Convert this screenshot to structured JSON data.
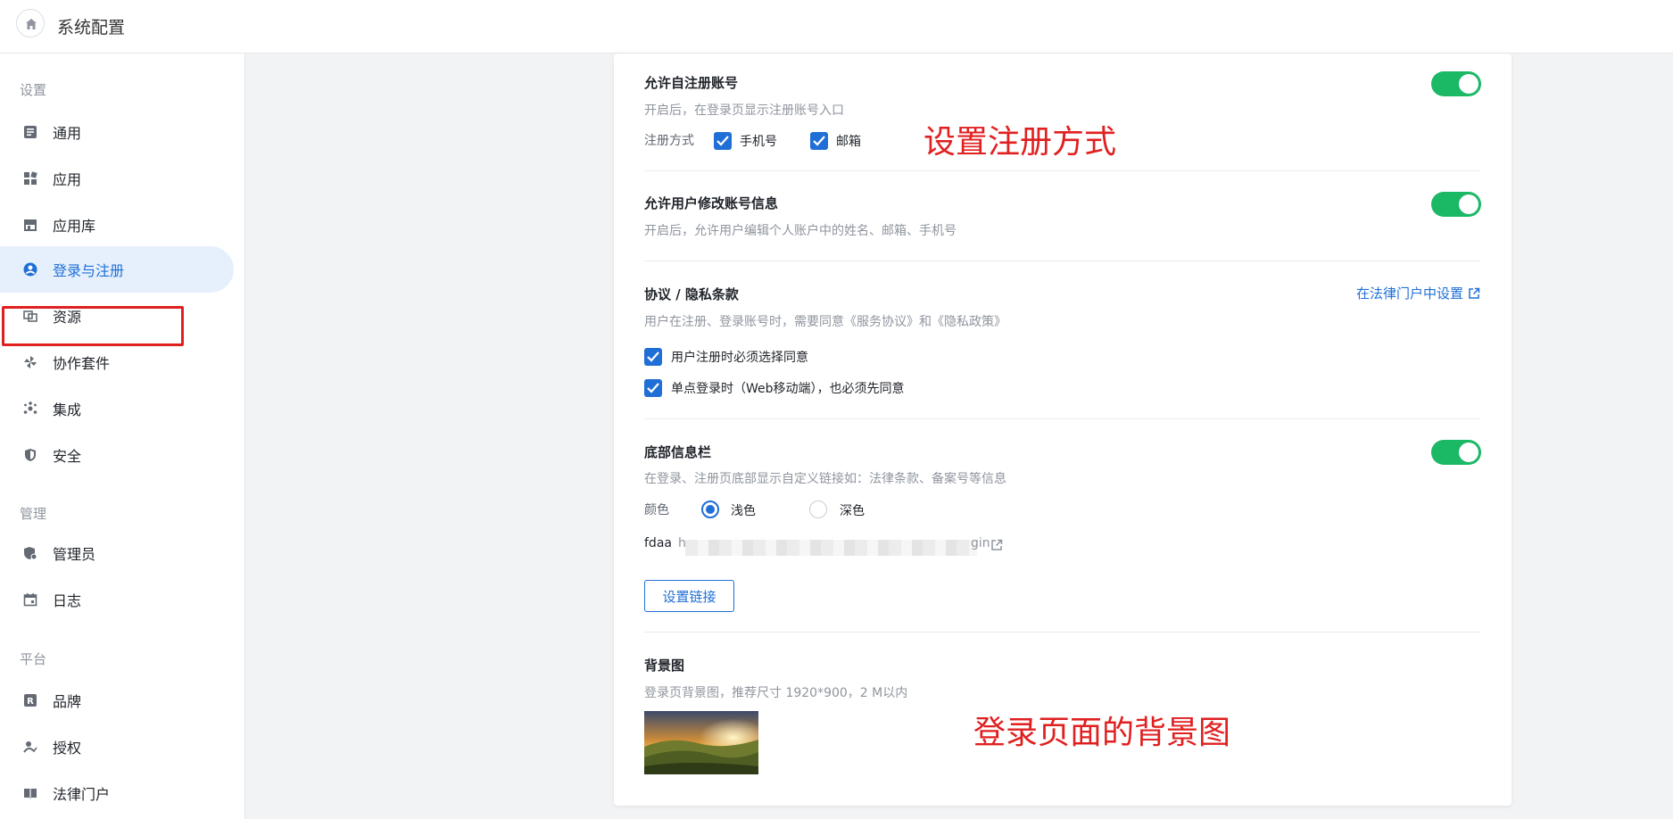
{
  "header": {
    "title": "系统配置"
  },
  "sidebar": {
    "groups": [
      {
        "label": "设置"
      },
      {
        "label": "管理"
      },
      {
        "label": "平台"
      }
    ],
    "items": [
      {
        "label": "通用"
      },
      {
        "label": "应用"
      },
      {
        "label": "应用库"
      },
      {
        "label": "登录与注册"
      },
      {
        "label": "资源"
      },
      {
        "label": "协作套件"
      },
      {
        "label": "集成"
      },
      {
        "label": "安全"
      },
      {
        "label": "管理员"
      },
      {
        "label": "日志"
      },
      {
        "label": "品牌"
      },
      {
        "label": "授权"
      },
      {
        "label": "法律门户"
      }
    ]
  },
  "main": {
    "self_register": {
      "title": "允许自注册账号",
      "desc": "开启后，在登录页显示注册账号入口",
      "enabled": true,
      "method_label": "注册方式",
      "methods": [
        {
          "label": "手机号",
          "checked": true
        },
        {
          "label": "邮箱",
          "checked": true
        }
      ]
    },
    "edit_info": {
      "title": "允许用户修改账号信息",
      "desc": "开启后，允许用户编辑个人账户中的姓名、邮箱、手机号",
      "enabled": true
    },
    "agreement": {
      "title": "协议 / 隐私条款",
      "desc": "用户在注册、登录账号时，需要同意《服务协议》和《隐私政策》",
      "link": "在法律门户中设置",
      "options": [
        {
          "label": "用户注册时必须选择同意",
          "checked": true
        },
        {
          "label": "单点登录时（Web移动端），也必须先同意",
          "checked": true
        }
      ]
    },
    "footer_bar": {
      "title": "底部信息栏",
      "desc": "在登录、注册页底部显示自定义链接如：法律条款、备案号等信息",
      "enabled": true,
      "color_label": "颜色",
      "colors": [
        {
          "label": "浅色",
          "selected": true
        },
        {
          "label": "深色",
          "selected": false
        }
      ],
      "link_name": "fdaa",
      "link_prefix": "h",
      "link_suffix": "gin",
      "button": "设置链接"
    },
    "background": {
      "title": "背景图",
      "desc": "登录页背景图，推荐尺寸 1920*900，2 M以内"
    }
  },
  "annotations": {
    "register_method": "设置注册方式",
    "background": "登录页面的背景图"
  },
  "colors": {
    "accent": "#1f6fd6",
    "toggle_on": "#1bb865",
    "annotation": "#e02020"
  }
}
